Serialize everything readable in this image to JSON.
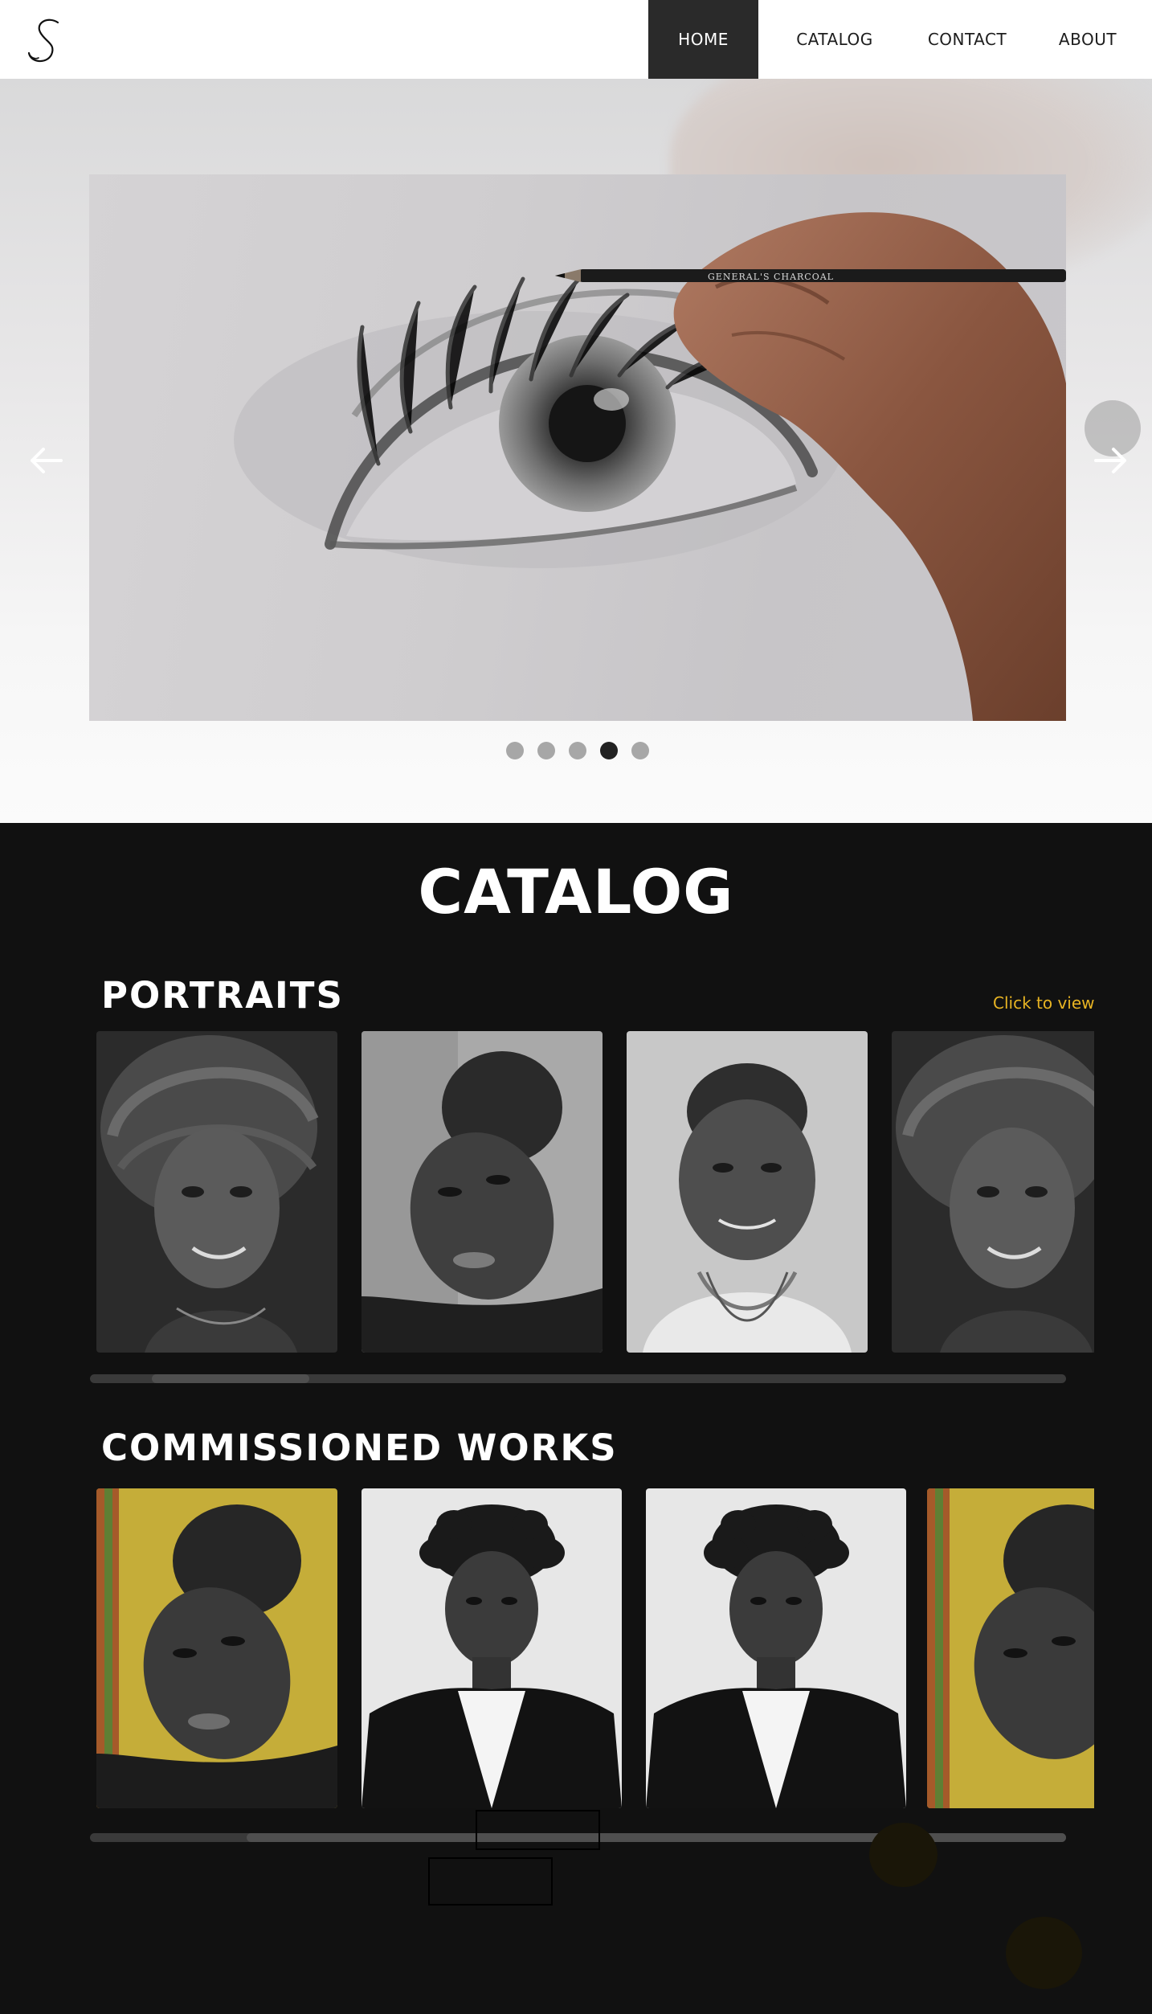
{
  "header": {
    "logo_icon": "script-s-logo-icon",
    "nav": [
      {
        "label": "HOME",
        "active": true
      },
      {
        "label": "CATALOG",
        "active": false
      },
      {
        "label": "CONTACT",
        "active": false
      },
      {
        "label": "ABOUT",
        "active": false
      }
    ]
  },
  "hero": {
    "prev_icon": "arrow-left-icon",
    "next_icon": "arrow-right-icon",
    "slide_count": 5,
    "active_slide": 4,
    "pencil_text": "GENERAL'S CHARCOAL"
  },
  "catalog": {
    "title": "CATALOG",
    "portraits": {
      "title": "PORTRAITS",
      "view_link": "Click to view",
      "scroll_position": 0.08
    },
    "commissioned": {
      "title": "COMMISSIONED  WORKS",
      "scroll_position": 0.0
    }
  },
  "colors": {
    "accent": "#e8b423",
    "dark_bg": "#111111",
    "nav_active_bg": "#2a2a2a"
  }
}
